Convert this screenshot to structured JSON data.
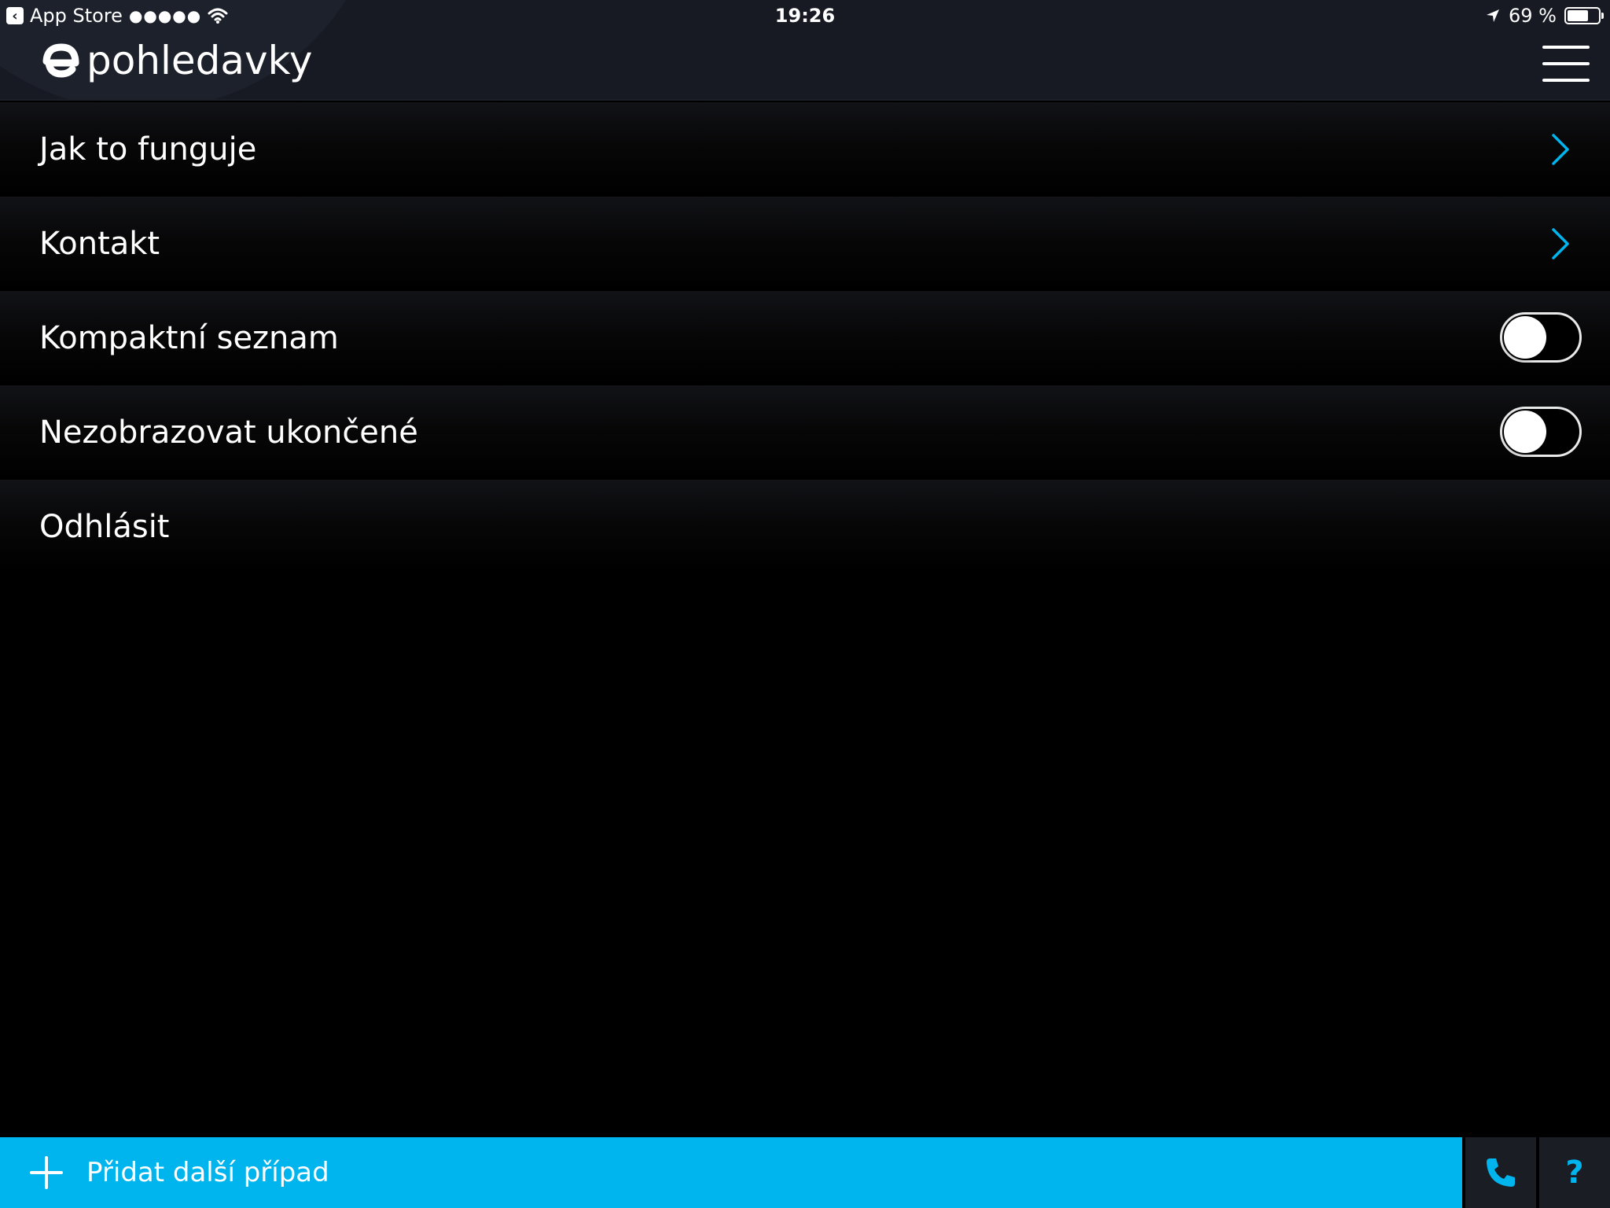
{
  "status_bar": {
    "back_app": "App Store",
    "signal": "●●●●●",
    "time": "19:26",
    "battery": "69 %",
    "battery_level": 0.69
  },
  "header": {
    "logo_text": "pohledavky"
  },
  "menu": {
    "items": [
      {
        "label": "Jak to funguje",
        "type": "link"
      },
      {
        "label": "Kontakt",
        "type": "link"
      },
      {
        "label": "Kompaktní seznam",
        "type": "toggle",
        "on": false
      },
      {
        "label": "Nezobrazovat ukončené",
        "type": "toggle",
        "on": false
      },
      {
        "label": "Odhlásit",
        "type": "action"
      }
    ]
  },
  "bottom_bar": {
    "add_label": "Přidat další případ",
    "help_label": "?"
  },
  "colors": {
    "accent": "#00b4ee",
    "header_bg": "#171a22",
    "background": "#000000"
  }
}
